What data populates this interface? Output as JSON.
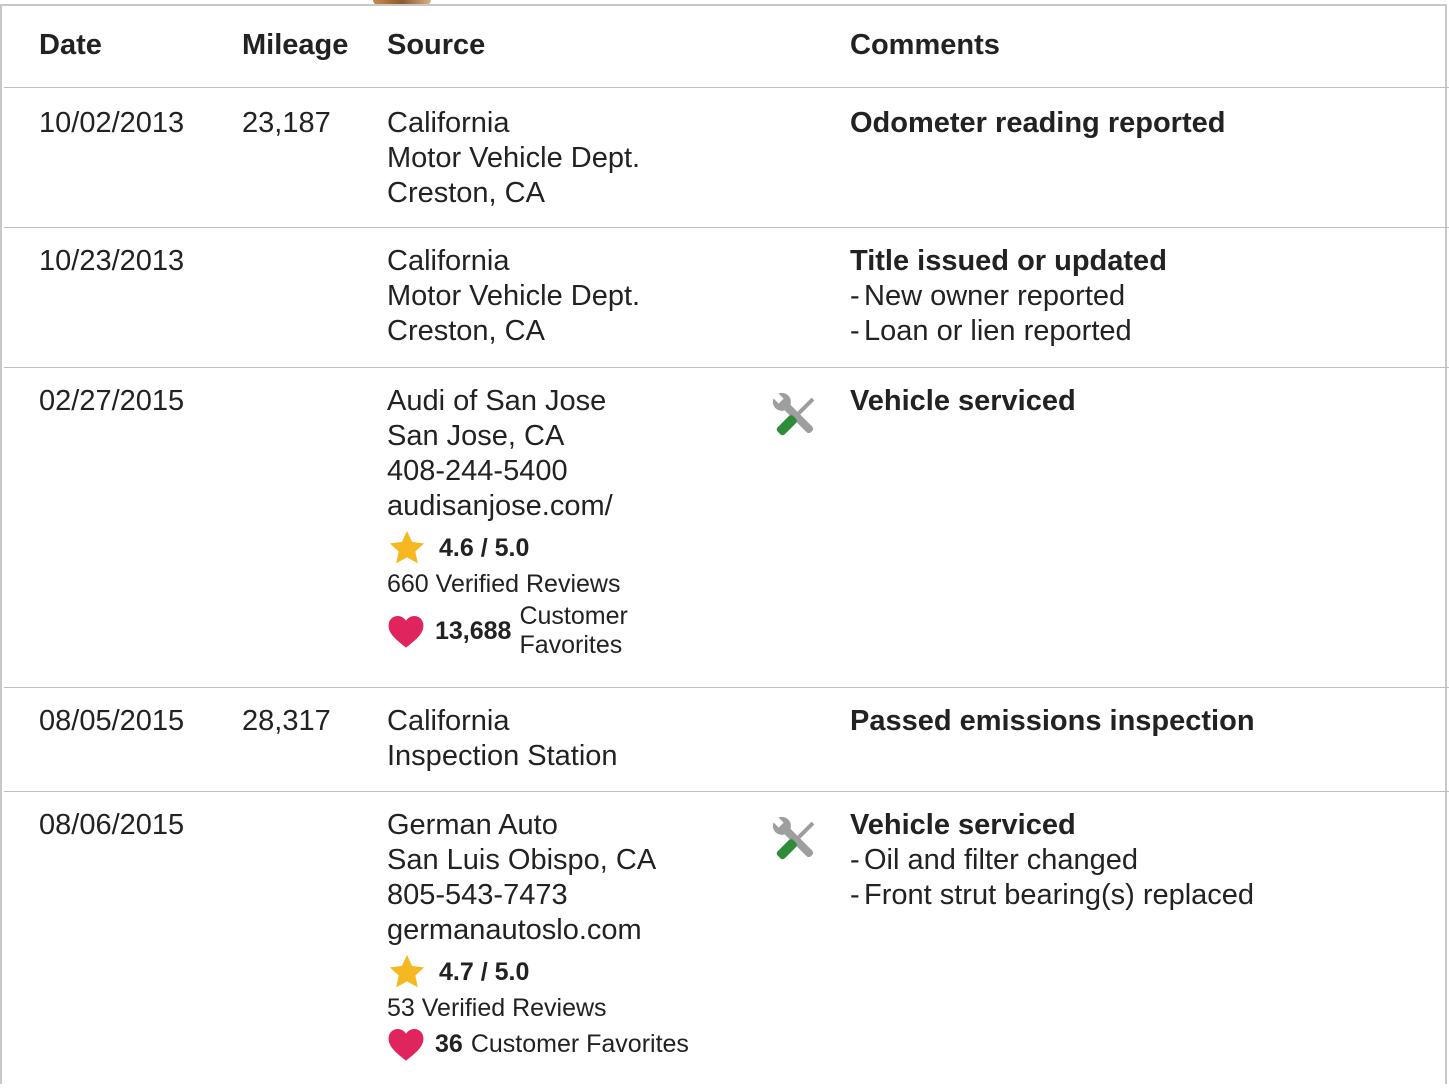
{
  "header": {
    "date": "Date",
    "mileage": "Mileage",
    "source": "Source",
    "comments": "Comments"
  },
  "rows": [
    {
      "date": "10/02/2013",
      "mileage": "23,187",
      "source": [
        "California",
        "Motor Vehicle Dept.",
        "Creston, CA"
      ],
      "comment_title": "Odometer reading reported",
      "comment_items": []
    },
    {
      "date": "10/23/2013",
      "mileage": "",
      "source": [
        "California",
        "Motor Vehicle Dept.",
        "Creston, CA"
      ],
      "comment_title": "Title issued or updated",
      "comment_items": [
        "New owner reported",
        "Loan or lien reported"
      ]
    },
    {
      "date": "02/27/2015",
      "mileage": "",
      "source": [
        "Audi of San Jose",
        "San Jose, CA",
        "408-244-5400",
        "audisanjose.com/"
      ],
      "rating": "4.6 / 5.0",
      "reviews": "660 Verified Reviews",
      "favorites_count": "13,688",
      "favorites_label": "Customer Favorites",
      "icon": "service-tools-icon",
      "comment_title": "Vehicle serviced",
      "comment_items": []
    },
    {
      "date": "08/05/2015",
      "mileage": "28,317",
      "source": [
        "California",
        "Inspection Station"
      ],
      "comment_title": "Passed emissions inspection",
      "comment_items": []
    },
    {
      "date": "08/06/2015",
      "mileage": "",
      "source": [
        "German Auto",
        "San Luis Obispo, CA",
        "805-543-7473",
        "germanautoslo.com"
      ],
      "rating": "4.7 / 5.0",
      "reviews": "53 Verified Reviews",
      "favorites_count": "36",
      "favorites_label": "Customer Favorites",
      "icon": "service-tools-icon",
      "comment_title": "Vehicle serviced",
      "comment_items": [
        "Oil and filter changed",
        "Front strut bearing(s) replaced"
      ]
    }
  ],
  "dash": "-",
  "colors": {
    "star": "#f5b820",
    "heart": "#e0245e",
    "wrench": "#9e9e9e",
    "screwdriver": "#2e8b3a",
    "border": "#bdbdbd"
  }
}
